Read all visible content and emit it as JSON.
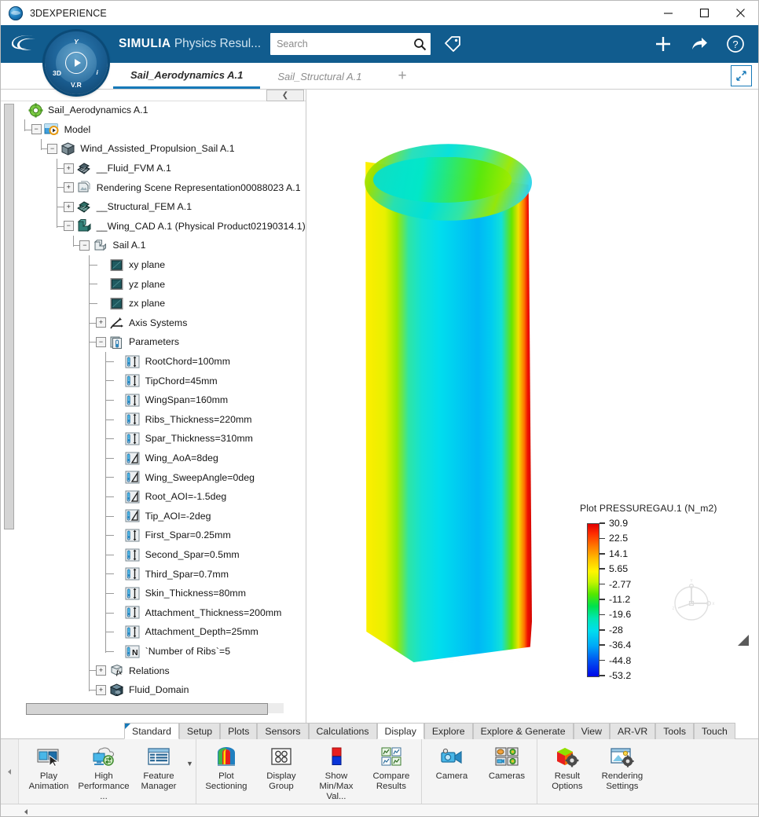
{
  "window": {
    "title": "3DEXPERIENCE",
    "logo_icon": "3dexperience-globe-icon",
    "minimize_icon": "minimize-icon",
    "maximize_icon": "maximize-icon",
    "close_icon": "close-icon"
  },
  "appbar": {
    "brand_icon": "ds-logo-icon",
    "compass": {
      "icon": "3d-compass-icon",
      "label_3d": "3D",
      "label_i": "i",
      "label_vr": "V.R",
      "label_y": "Y"
    },
    "app_name_bold": "SIMULIA",
    "app_name_rest": " Physics Resul...",
    "search": {
      "value": "",
      "placeholder": "Search",
      "icon": "search-icon"
    },
    "tag_icon": "tag-icon",
    "add_icon": "plus-icon",
    "share_icon": "share-arrow-icon",
    "help_icon": "help-question-icon"
  },
  "tabs": {
    "items": [
      {
        "label": "Sail_Aerodynamics A.1",
        "active": true
      },
      {
        "label": "Sail_Structural A.1",
        "active": false
      }
    ],
    "add_label": "+",
    "restore_icon": "restore-down-icon"
  },
  "tree": {
    "collapse_icon": "chevron-left-icon",
    "nodes": [
      {
        "depth": 0,
        "expander": "none",
        "icon": "gear-green-icon",
        "label": "Sail_Aerodynamics A.1"
      },
      {
        "depth": 1,
        "expander": "minus",
        "icon": "model-play-icon",
        "label": "Model"
      },
      {
        "depth": 2,
        "expander": "minus",
        "icon": "product-cube-icon",
        "label": "Wind_Assisted_Propulsion_Sail A.1"
      },
      {
        "depth": 3,
        "expander": "plus",
        "icon": "fluid-mesh-icon",
        "label": "__Fluid_FVM A.1"
      },
      {
        "depth": 3,
        "expander": "plus",
        "icon": "rendering-scene-icon",
        "label": "Rendering Scene Representation00088023 A.1"
      },
      {
        "depth": 3,
        "expander": "plus",
        "icon": "structural-mesh-icon",
        "label": "__Structural_FEM A.1"
      },
      {
        "depth": 3,
        "expander": "minus",
        "icon": "cad-part-icon",
        "label": "__Wing_CAD A.1 (Physical Product02190314.1)"
      },
      {
        "depth": 4,
        "expander": "minus",
        "icon": "part-body-icon",
        "label": "Sail A.1"
      },
      {
        "depth": 5,
        "expander": "none",
        "icon": "plane-icon",
        "label": "xy plane"
      },
      {
        "depth": 5,
        "expander": "none",
        "icon": "plane-icon",
        "label": "yz plane"
      },
      {
        "depth": 5,
        "expander": "none",
        "icon": "plane-icon",
        "label": "zx plane"
      },
      {
        "depth": 5,
        "expander": "plus",
        "icon": "axis-system-icon",
        "label": "Axis Systems"
      },
      {
        "depth": 5,
        "expander": "minus",
        "icon": "parameters-icon",
        "label": "Parameters"
      },
      {
        "depth": 6,
        "expander": "none",
        "icon": "length-parameter-icon",
        "label": "RootChord=100mm"
      },
      {
        "depth": 6,
        "expander": "none",
        "icon": "length-parameter-icon",
        "label": "TipChord=45mm"
      },
      {
        "depth": 6,
        "expander": "none",
        "icon": "length-parameter-icon",
        "label": "WingSpan=160mm"
      },
      {
        "depth": 6,
        "expander": "none",
        "icon": "length-parameter-icon",
        "label": "Ribs_Thickness=220mm"
      },
      {
        "depth": 6,
        "expander": "none",
        "icon": "length-parameter-icon",
        "label": "Spar_Thickness=310mm"
      },
      {
        "depth": 6,
        "expander": "none",
        "icon": "angle-parameter-icon",
        "label": "Wing_AoA=8deg"
      },
      {
        "depth": 6,
        "expander": "none",
        "icon": "angle-parameter-icon",
        "label": "Wing_SweepAngle=0deg"
      },
      {
        "depth": 6,
        "expander": "none",
        "icon": "angle-parameter-icon",
        "label": "Root_AOI=-1.5deg"
      },
      {
        "depth": 6,
        "expander": "none",
        "icon": "angle-parameter-icon",
        "label": "Tip_AOI=-2deg"
      },
      {
        "depth": 6,
        "expander": "none",
        "icon": "length-parameter-icon",
        "label": "First_Spar=0.25mm"
      },
      {
        "depth": 6,
        "expander": "none",
        "icon": "length-parameter-icon",
        "label": "Second_Spar=0.5mm"
      },
      {
        "depth": 6,
        "expander": "none",
        "icon": "length-parameter-icon",
        "label": "Third_Spar=0.7mm"
      },
      {
        "depth": 6,
        "expander": "none",
        "icon": "length-parameter-icon",
        "label": "Skin_Thickness=80mm"
      },
      {
        "depth": 6,
        "expander": "none",
        "icon": "length-parameter-icon",
        "label": "Attachment_Thickness=200mm"
      },
      {
        "depth": 6,
        "expander": "none",
        "icon": "length-parameter-icon",
        "label": "Attachment_Depth=25mm"
      },
      {
        "depth": 6,
        "expander": "none",
        "icon": "integer-parameter-icon",
        "label": "`Number of Ribs`=5"
      },
      {
        "depth": 5,
        "expander": "plus",
        "icon": "relations-fx-icon",
        "label": "Relations"
      },
      {
        "depth": 5,
        "expander": "plus",
        "icon": "fluid-domain-icon",
        "label": "Fluid_Domain"
      }
    ]
  },
  "viewport": {
    "compass_icon": "view-axis-compass-icon",
    "compass_labels": {
      "x": "x",
      "y": "Y",
      "z": "z"
    },
    "corner_icon": "corner-arrow-icon"
  },
  "legend": {
    "title": "Plot PRESSUREGAU.1 (N_m2)",
    "values": [
      "30.9",
      "22.5",
      "14.1",
      "5.65",
      "-2.77",
      "-11.2",
      "-19.6",
      "-28",
      "-36.4",
      "-44.8",
      "-53.2"
    ],
    "max": 30.9,
    "min": -53.2,
    "unit": "N_m2",
    "quantity": "PRESSUREGAU.1"
  },
  "ribbon": {
    "tabs": [
      {
        "label": "Standard",
        "selected": true
      },
      {
        "label": "Setup",
        "selected": false
      },
      {
        "label": "Plots",
        "selected": false
      },
      {
        "label": "Sensors",
        "selected": false
      },
      {
        "label": "Calculations",
        "selected": false
      },
      {
        "label": "Display",
        "selected": true
      },
      {
        "label": "Explore",
        "selected": false
      },
      {
        "label": "Explore & Generate",
        "selected": false
      },
      {
        "label": "View",
        "selected": false
      },
      {
        "label": "AR-VR",
        "selected": false
      },
      {
        "label": "Tools",
        "selected": false
      },
      {
        "label": "Touch",
        "selected": false
      }
    ],
    "groups": [
      {
        "buttons": [
          {
            "label": "Play\nAnimation",
            "icon": "play-animation-icon"
          },
          {
            "label": "High\nPerformance ...",
            "icon": "high-performance-icon"
          },
          {
            "label": "Feature\nManager",
            "icon": "feature-manager-icon",
            "caret": true
          }
        ]
      },
      {
        "buttons": [
          {
            "label": "Plot\nSectioning",
            "icon": "plot-sectioning-icon"
          },
          {
            "label": "Display\nGroup",
            "icon": "display-group-icon"
          },
          {
            "label": "Show\nMin/Max Val...",
            "icon": "show-minmax-icon"
          },
          {
            "label": "Compare\nResults",
            "icon": "compare-results-icon"
          }
        ]
      },
      {
        "buttons": [
          {
            "label": "Camera",
            "icon": "camera-icon"
          },
          {
            "label": "Cameras",
            "icon": "cameras-icon"
          }
        ]
      },
      {
        "buttons": [
          {
            "label": "Result\nOptions",
            "icon": "result-options-icon"
          },
          {
            "label": "Rendering\nSettings",
            "icon": "rendering-settings-icon"
          }
        ]
      }
    ],
    "status_arrow_icon": "scroll-left-arrow-icon"
  }
}
